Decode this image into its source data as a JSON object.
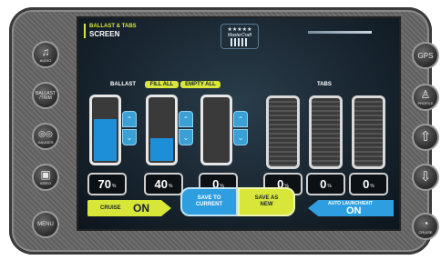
{
  "sidebar_left": [
    {
      "id": "audio",
      "icon": "music-note-icon",
      "glyph": "♫",
      "label": "AUDIO"
    },
    {
      "id": "ballast",
      "icon": "none",
      "glyph": "",
      "label": "BALLAST\n/TRIM"
    },
    {
      "id": "gauges",
      "icon": "gauges-icon",
      "glyph": "◎◎",
      "label": "GAUGES"
    },
    {
      "id": "video",
      "icon": "video-icon",
      "glyph": "▣",
      "label": "VIDEO"
    },
    {
      "id": "menu",
      "icon": "none",
      "glyph": "",
      "label": "MENU"
    }
  ],
  "sidebar_right": [
    {
      "id": "gps",
      "icon": "none",
      "glyph": "",
      "label": "GPS"
    },
    {
      "id": "profile",
      "icon": "person-icon",
      "glyph": "♙",
      "label": "PROFILE"
    },
    {
      "id": "up",
      "icon": "up-arrow-icon",
      "glyph": "⇧",
      "label": ""
    },
    {
      "id": "down",
      "icon": "down-arrow-icon",
      "glyph": "⇩",
      "label": ""
    },
    {
      "id": "cruise",
      "icon": "speedometer-icon",
      "glyph": "◔",
      "label": "CRUISE"
    }
  ],
  "screen": {
    "title_line1": "BALLAST & TABS",
    "title_line2": "SCREEN",
    "logo_text": "MasterCraft",
    "ballast_label": "BALLAST",
    "fill_all": "FILL ALL",
    "empty_all": "EMPTY ALL",
    "tabs_label": "TABS",
    "ballast_tanks": [
      {
        "percent": "70",
        "unit": "%",
        "fill_level": 0.7
      },
      {
        "percent": "40",
        "unit": "%",
        "fill_level": 0.4
      },
      {
        "percent": "0",
        "unit": "%",
        "fill_level": 0
      }
    ],
    "tabs": [
      {
        "percent": "0",
        "unit": "%"
      },
      {
        "percent": "0",
        "unit": "%"
      },
      {
        "percent": "0",
        "unit": "%"
      }
    ],
    "cruise": {
      "label": "CRUISE",
      "state": "ON"
    },
    "save_to_current": "SAVE TO CURRENT",
    "save_as_new": "SAVE AS NEW",
    "auto_launch": {
      "label": "AUTO LAUNCH/EXIT",
      "state": "ON"
    }
  },
  "colors": {
    "accent_yellow": "#d8e63a",
    "accent_blue": "#2f9ee0",
    "tank_fill": "#1c8fd8"
  }
}
